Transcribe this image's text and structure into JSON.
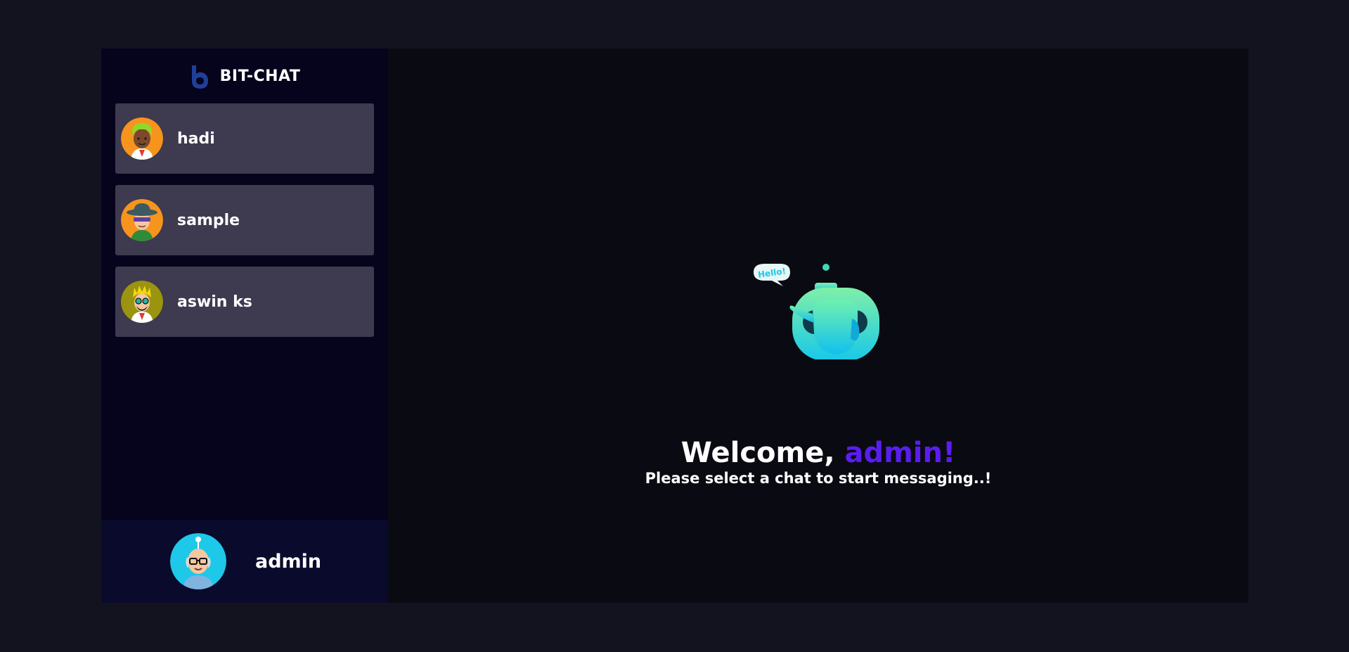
{
  "brand": {
    "name": "BIT-CHAT",
    "logo_color": "#1f3f9a"
  },
  "chats": [
    {
      "name": "hadi",
      "avatar": "avatar-green-hair"
    },
    {
      "name": "sample",
      "avatar": "avatar-hat-sunglasses"
    },
    {
      "name": "aswin ks",
      "avatar": "avatar-yellow-hair-glasses"
    }
  ],
  "current_user": {
    "name": "admin",
    "avatar": "avatar-bald-glasses"
  },
  "welcome": {
    "greeting": "Welcome, ",
    "name": "admin!",
    "subtitle": "Please select a chat to start messaging..!",
    "accent_color": "#5a1df0"
  },
  "robot": {
    "bubble_text": "Hello!"
  },
  "colors": {
    "page_bg": "#131320",
    "sidebar_bg": "#06031c",
    "chat_item_bg": "#3e3a4f",
    "footer_bg": "#0a0a2c",
    "main_bg": "#0a0a12"
  }
}
